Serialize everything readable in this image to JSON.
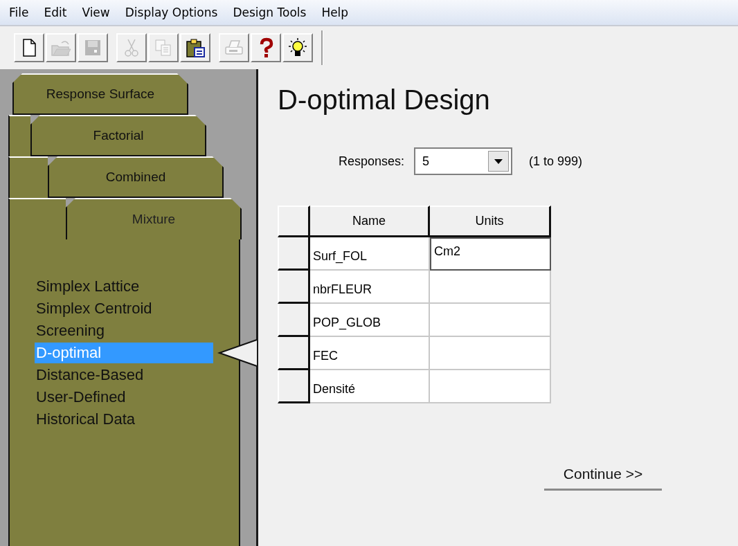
{
  "menu": [
    "File",
    "Edit",
    "View",
    "Display Options",
    "Design Tools",
    "Help"
  ],
  "toolbar": [
    [
      {
        "kind": "new",
        "disabled": false
      },
      {
        "kind": "open",
        "disabled": true
      },
      {
        "kind": "save",
        "disabled": true
      }
    ],
    [
      {
        "kind": "cut",
        "disabled": true
      },
      {
        "kind": "copy",
        "disabled": true
      },
      {
        "kind": "paste",
        "disabled": false
      }
    ],
    [
      {
        "kind": "print",
        "disabled": true
      },
      {
        "kind": "help",
        "disabled": false
      },
      {
        "kind": "tip",
        "disabled": false
      }
    ]
  ],
  "design_tabs": [
    {
      "label": "Response Surface",
      "selected": false
    },
    {
      "label": "Factorial",
      "selected": false
    },
    {
      "label": "Combined",
      "selected": false
    },
    {
      "label": "Mixture",
      "selected": true
    }
  ],
  "design_types": [
    {
      "label": "Simplex Lattice",
      "selected": false
    },
    {
      "label": "Simplex Centroid",
      "selected": false
    },
    {
      "label": "Screening",
      "selected": false
    },
    {
      "label": "D-optimal",
      "selected": true
    },
    {
      "label": "Distance-Based",
      "selected": false
    },
    {
      "label": "User-Defined",
      "selected": false
    },
    {
      "label": "Historical Data",
      "selected": false
    }
  ],
  "title": "D-optimal Design",
  "responses": {
    "label": "Responses:",
    "value": "5",
    "range": "(1 to 999)"
  },
  "table": {
    "columns": [
      "Name",
      "Units"
    ],
    "rows": [
      {
        "name": "Surf_FOL",
        "units": "Cm2",
        "focused": true
      },
      {
        "name": "nbrFLEUR",
        "units": "",
        "focused": false
      },
      {
        "name": "POP_GLOB",
        "units": "",
        "focused": false
      },
      {
        "name": "FEC",
        "units": "",
        "focused": false
      },
      {
        "name": "Densité",
        "units": "",
        "focused": false
      }
    ]
  },
  "continue_button": "Continue >>"
}
